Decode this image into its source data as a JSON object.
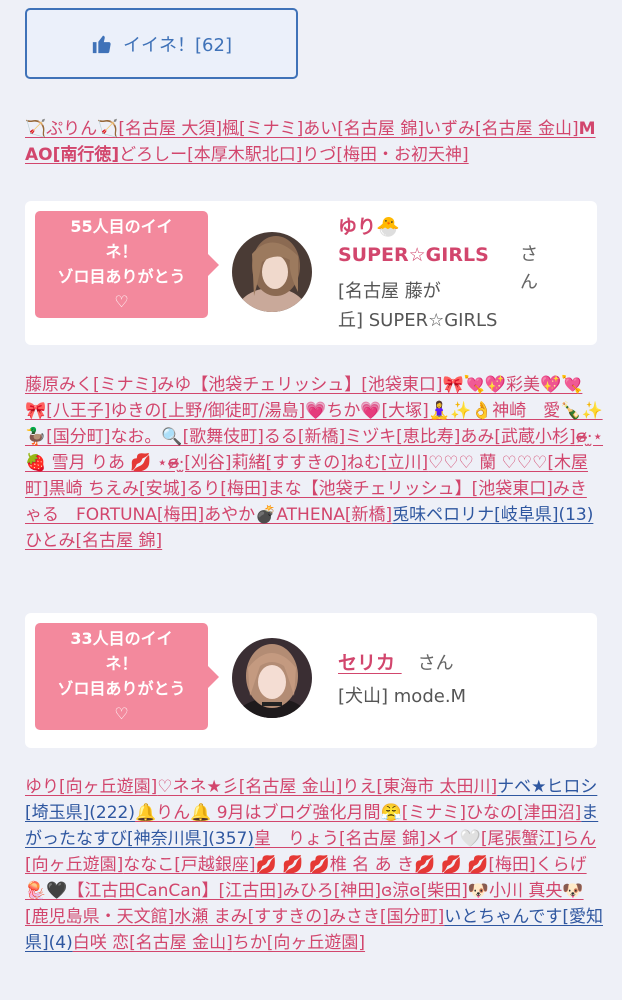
{
  "like_button": {
    "label": "イイネ！[62]"
  },
  "names_top": [
    "🏹ぷりん🏹[名古屋 大須]",
    "楓[ミナミ]",
    "あい[名古屋 錦]",
    "いずみ[名古屋 金山]",
    "MAO[南行徳]",
    "どろしー[本厚木駅北口]",
    "りづ[梅田・お初天神]"
  ],
  "card1": {
    "bubble_line1": "55人目のイイ",
    "bubble_line2": "ネ！",
    "bubble_line3": "ゾロ目ありがとう",
    "bubble_heart": "♡",
    "name": "ゆり🐣 SUPER☆GIRLS",
    "san": "さん",
    "shop_line1": "[名古屋 藤が",
    "shop_line2": "丘] SUPER☆GIRLS"
  },
  "names_mid": [
    "藤原みく[ミナミ]",
    "みゆ【池袋チェリッシュ】[池袋東口]",
    "🎀💘💖彩美💖💘🎀[八王子]",
    "ゆきの[上野/御徒町/湯島]",
    "💗ちか💗[大塚]",
    "🧘‍♀️✨👌神崎　愛🍾✨🦆[国分町]",
    "なお。🔍[歌舞伎町]",
    "るる[新橋]",
    "ミヅキ[恵比寿]",
    "あみ[武蔵小杉]",
    "ɞ̴̶̷·̫⋆🍓 雪月 りあ 💋 ⋆ɞ̴̶̷·̫[刈谷]",
    "莉緒[すすきの]",
    "ねむ[立川]",
    "♡♡♡ 蘭 ♡♡♡[木屋町]",
    "黒崎 ちえみ[安城]",
    "るり[梅田]",
    "まな【池袋チェリッシュ】[池袋東口]",
    "みきゃる　FORTUNA[梅田]",
    "あやか💣ATHENA[新橋]",
    "兎味ペロリナ[岐阜県](13)",
    "ひとみ[名古屋 錦]"
  ],
  "card2": {
    "bubble_line1": "33人目のイイ",
    "bubble_line2": "ネ！",
    "bubble_line3": "ゾロ目ありがとう",
    "bubble_heart": "♡",
    "name": "セリカ",
    "san": "さん",
    "shop": "[犬山] mode.M"
  },
  "names_bottom": [
    "ゆり[向ヶ丘遊園]",
    "♡ネネ★彡[名古屋 金山]",
    "りえ[東海市 太田川]",
    "ナベ★ヒロシ[埼玉県](222)",
    "🔔りん🔔 9月はブログ強化月間😤[ミナミ]",
    "ひなの[津田沼]",
    "まがったなすび[神奈川県](357)",
    "皇　りょう[名古屋 錦]",
    "メイ🤍[尾張蟹江]",
    "らん[向ヶ丘遊園]",
    "ななこ[戸越銀座]",
    "💋 💋 💋椎 名 あ き💋 💋 💋[梅田]",
    "くらげ🪼🖤【江古田CanCan】[江古田]",
    "みひろ[神田]",
    "ɞ涼ɞ[柴田]",
    "🐶小川 真央🐶[鹿児島県・天文館]",
    "水瀬 まみ[すすきの]",
    "みさき[国分町]",
    "いとちゃんです[愛知県](4)",
    "白咲 恋[名古屋 金山]",
    "ちか[向ヶ丘遊園]"
  ],
  "colors": {
    "pink": "#d2466d",
    "blue": "#2f57a0",
    "bubble": "#f3899d",
    "button_border": "#3f72b8"
  }
}
